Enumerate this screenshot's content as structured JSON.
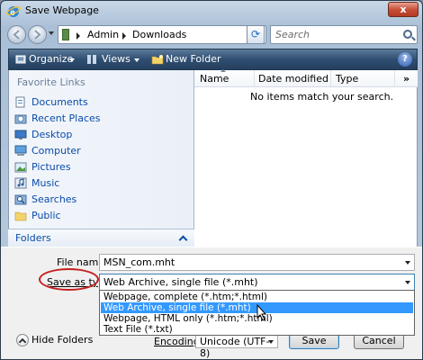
{
  "window": {
    "title": "Save Webpage",
    "close_label": "x"
  },
  "address": {
    "crumbs": [
      "Admin",
      "Downloads"
    ],
    "search_placeholder": "Search"
  },
  "toolbar": {
    "organize": "Organize",
    "views": "Views",
    "new_folder": "New Folder",
    "help": "?"
  },
  "sidebar": {
    "title": "Favorite Links",
    "items": [
      {
        "label": "Documents",
        "icon": "documents-icon"
      },
      {
        "label": "Recent Places",
        "icon": "recent-places-icon"
      },
      {
        "label": "Desktop",
        "icon": "desktop-icon"
      },
      {
        "label": "Computer",
        "icon": "computer-icon"
      },
      {
        "label": "Pictures",
        "icon": "pictures-icon"
      },
      {
        "label": "Music",
        "icon": "music-icon"
      },
      {
        "label": "Searches",
        "icon": "searches-icon"
      },
      {
        "label": "Public",
        "icon": "public-icon"
      }
    ],
    "folders_label": "Folders"
  },
  "filelist": {
    "columns": [
      "Name",
      "Date modified",
      "Type"
    ],
    "more": "»",
    "empty_message": "No items match your search."
  },
  "form": {
    "file_name_label": "File name:",
    "file_name_value": "MSN_com.mht",
    "save_as_type_label": "Save as type:",
    "save_as_type_value": "Web Archive, single file (*.mht)",
    "type_options": [
      "Webpage, complete (*.htm;*.html)",
      "Web Archive, single file (*.mht)",
      "Webpage, HTML only (*.htm;*.html)",
      "Text File (*.txt)"
    ],
    "selected_option_index": 1,
    "encoding_label": "Encoding:",
    "encoding_value": "Unicode (UTF-8)"
  },
  "buttons": {
    "hide_folders": "Hide Folders",
    "save": "Save",
    "cancel": "Cancel"
  },
  "colors": {
    "accent": "#3399ff",
    "link": "#0a4ba8",
    "highlight_ring": "#c42020"
  }
}
